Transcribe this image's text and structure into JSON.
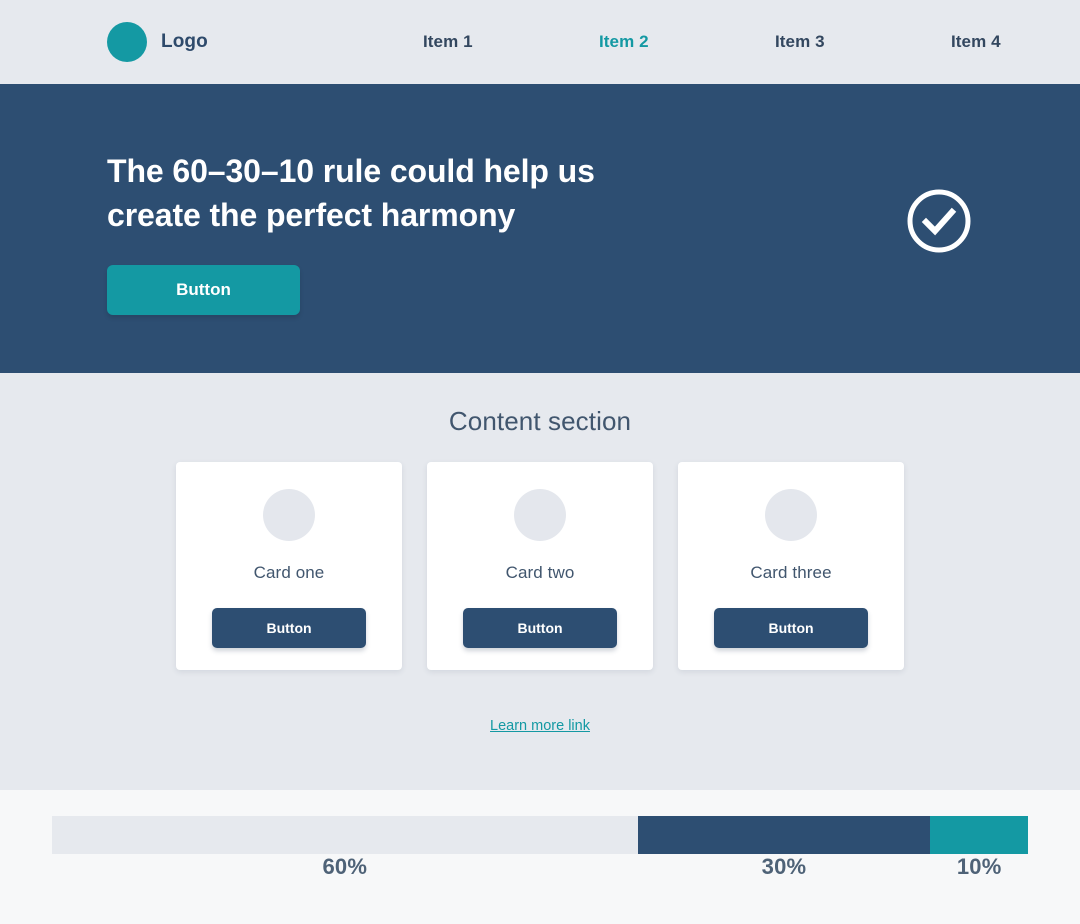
{
  "header": {
    "logo_icon": "circle-logo-icon",
    "logo_label": "Logo",
    "nav_items": [
      {
        "label": "Item 1",
        "active": false
      },
      {
        "label": "Item 2",
        "active": true
      },
      {
        "label": "Item 3",
        "active": false
      },
      {
        "label": "Item 4",
        "active": false
      }
    ]
  },
  "hero": {
    "title": "The 60–30–10 rule could help us create the perfect harmony",
    "button_label": "Button",
    "icon": "check-circle-icon"
  },
  "content": {
    "title": "Content section",
    "cards": [
      {
        "media_icon": "placeholder-circle-icon",
        "title": "Card one",
        "button_label": "Button"
      },
      {
        "media_icon": "placeholder-circle-icon",
        "title": "Card two",
        "button_label": "Button"
      },
      {
        "media_icon": "placeholder-circle-icon",
        "title": "Card three",
        "button_label": "Button"
      }
    ],
    "link_label": "Learn more link"
  },
  "footer": {
    "ratio_segments": [
      {
        "label": "60%",
        "percent": 60,
        "color": "#e6e9ee",
        "role": "primary"
      },
      {
        "label": "30%",
        "percent": 30,
        "color": "#2d4e72",
        "role": "secondary"
      },
      {
        "label": "10%",
        "percent": 10,
        "color": "#1499a3",
        "role": "accent"
      }
    ]
  },
  "palette": {
    "accent_teal": "#1499a3",
    "navy": "#2d4e72",
    "light_gray": "#e6e9ee",
    "page_bg": "#f7f8f9",
    "text_slate": "#41566e"
  }
}
